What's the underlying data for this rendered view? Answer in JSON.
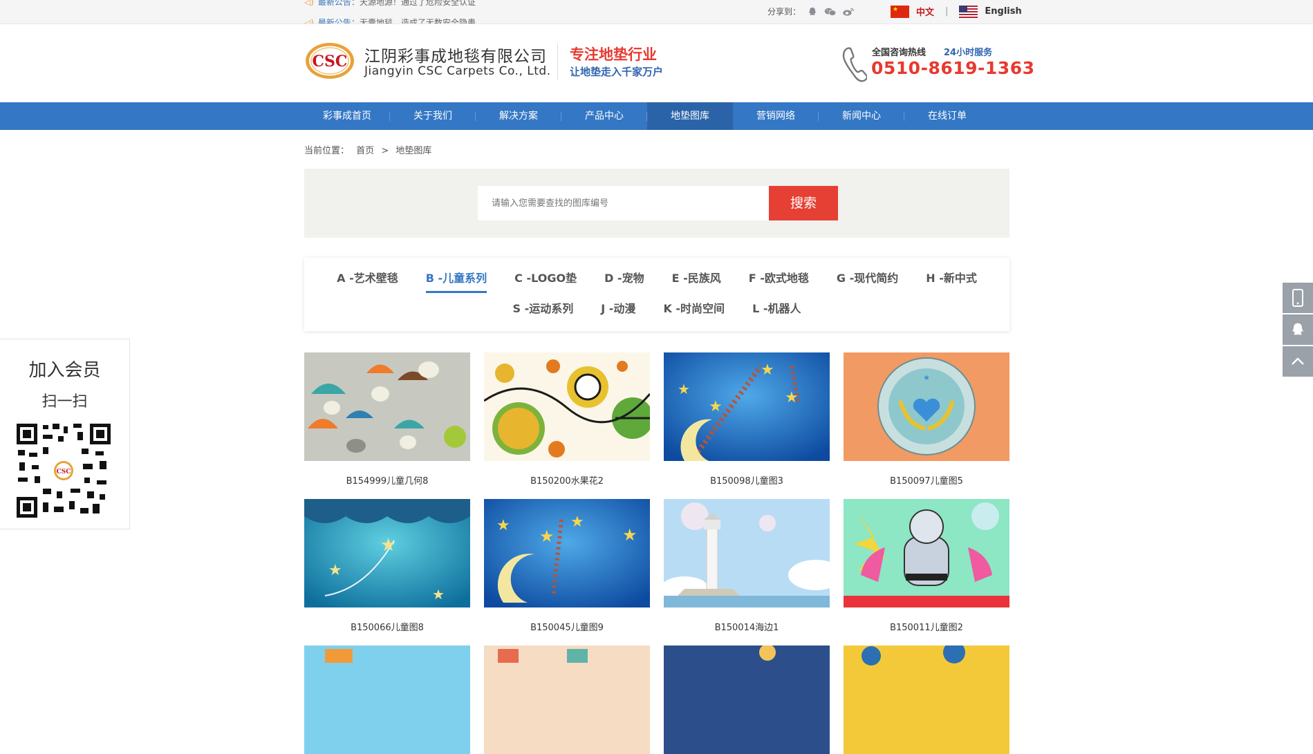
{
  "topbar": {
    "notices": [
      {
        "tag": "最新公告：",
        "text": "天源地源！通过了危险安全认证"
      },
      {
        "tag": "最新公告：",
        "text": "无囊地毯，造成了无数安全隐患"
      }
    ],
    "share_label": "分享到：",
    "share_icons": [
      "qq-icon",
      "wechat-icon",
      "weibo-icon"
    ],
    "lang_cn": "中文",
    "lang_sep": "|",
    "lang_en": "English"
  },
  "header": {
    "logo_text": "CSC",
    "company_cn": "江阴彩事成地毯有限公司",
    "company_en": "Jiangyin CSC Carpets Co., Ltd.",
    "slogan1": "专注地垫行业",
    "slogan2": "让地垫走入千家万户",
    "hotline_label": "全国咨询热线",
    "hotline_24": "24小时服务",
    "hotline_number": "0510-8619-1363"
  },
  "nav": [
    {
      "label": "彩事成首页",
      "active": false
    },
    {
      "label": "关于我们",
      "active": false
    },
    {
      "label": "解决方案",
      "active": false
    },
    {
      "label": "产品中心",
      "active": false
    },
    {
      "label": "地垫图库",
      "active": true
    },
    {
      "label": "营销网络",
      "active": false
    },
    {
      "label": "新闻中心",
      "active": false
    },
    {
      "label": "在线订单",
      "active": false
    }
  ],
  "breadcrumb": {
    "label": "当前位置：",
    "home": "首页",
    "sep": ">",
    "current": "地垫图库"
  },
  "search": {
    "placeholder": "请输入您需要查找的图库编号",
    "button": "搜索"
  },
  "categories_row1": [
    {
      "label": "A -艺术壁毯",
      "active": false
    },
    {
      "label": "B -儿童系列",
      "active": true
    },
    {
      "label": "C -LOGO垫",
      "active": false
    },
    {
      "label": "D -宠物",
      "active": false
    },
    {
      "label": "E -民族风",
      "active": false
    },
    {
      "label": "F -欧式地毯",
      "active": false
    },
    {
      "label": "G -现代简约",
      "active": false
    },
    {
      "label": "H -新中式",
      "active": false
    }
  ],
  "categories_row2": [
    {
      "label": "S -运动系列",
      "active": false
    },
    {
      "label": "J -动漫",
      "active": false
    },
    {
      "label": "K -时尚空间",
      "active": false
    },
    {
      "label": "L -机器人",
      "active": false
    }
  ],
  "products": [
    {
      "caption": "B154999儿童几何8",
      "theme": "rain"
    },
    {
      "caption": "B150200水果花2",
      "theme": "fruit"
    },
    {
      "caption": "B150098儿童图3",
      "theme": "stars"
    },
    {
      "caption": "B150097儿童图5",
      "theme": "badge"
    },
    {
      "caption": "B150066儿童图8",
      "theme": "teal-stars"
    },
    {
      "caption": "B150045儿童图9",
      "theme": "moon"
    },
    {
      "caption": "B150014海边1",
      "theme": "lighthouse"
    },
    {
      "caption": "B150011儿童图2",
      "theme": "robot"
    }
  ],
  "member": {
    "title": "加入会员",
    "subtitle": "扫一扫"
  },
  "side_buttons": [
    "mobile-icon",
    "qq-icon",
    "back-to-top-icon"
  ],
  "colors": {
    "nav": "#3477c4",
    "nav_active": "#2a63a8",
    "accent_red": "#e64034",
    "link_blue": "#3477c4"
  }
}
